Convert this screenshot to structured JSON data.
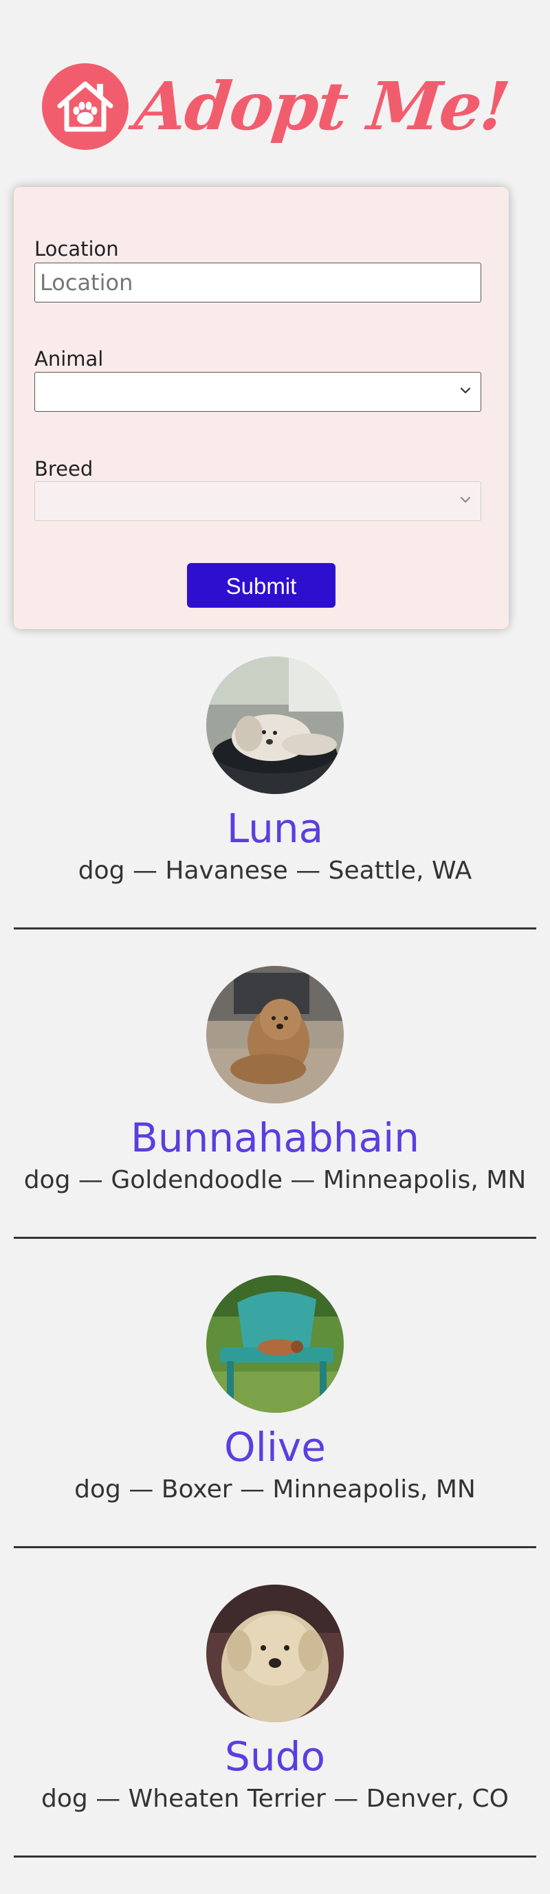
{
  "header": {
    "logo_text": "Adopt Me!",
    "brand_color": "#f25d6e",
    "logo_icon": "house-paw-icon"
  },
  "search": {
    "location_label": "Location",
    "location_placeholder": "Location",
    "location_value": "",
    "animal_label": "Animal",
    "animal_value": "",
    "breed_label": "Breed",
    "breed_value": "",
    "breed_disabled": true,
    "submit_label": "Submit",
    "submit_color": "#2e0fd0",
    "card_color": "#faebeb"
  },
  "pets": [
    {
      "name": "Luna",
      "info": "dog — Havanese — Seattle, WA"
    },
    {
      "name": "Bunnahabhain",
      "info": "dog — Goldendoodle — Minneapolis, MN"
    },
    {
      "name": "Olive",
      "info": "dog — Boxer — Minneapolis, MN"
    },
    {
      "name": "Sudo",
      "info": "dog — Wheaten Terrier — Denver, CO"
    }
  ],
  "colors": {
    "pet_name": "#5b3ee0",
    "background": "#f2f2f2"
  }
}
